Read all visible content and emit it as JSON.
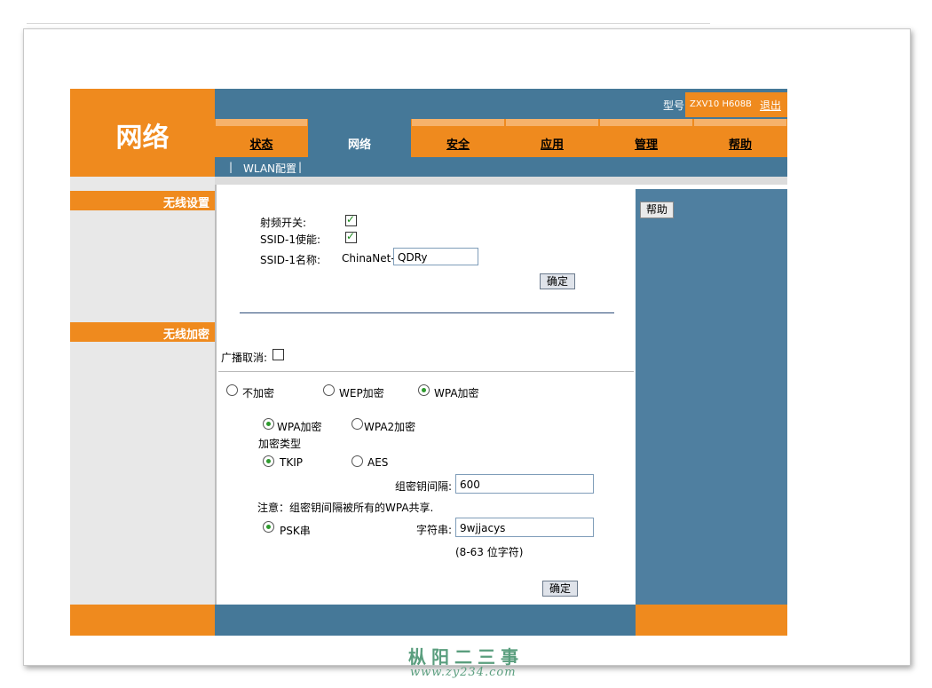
{
  "header": {
    "brand_title": "网络",
    "model_label": "型号",
    "model_value": "ZXV10 H608B",
    "logout_label": "退出"
  },
  "tabs": [
    {
      "label": "状态",
      "active": false
    },
    {
      "label": "网络",
      "active": true
    },
    {
      "label": "安全",
      "active": false
    },
    {
      "label": "应用",
      "active": false
    },
    {
      "label": "管理",
      "active": false
    },
    {
      "label": "帮助",
      "active": false
    }
  ],
  "subnav": {
    "sep_left": "|",
    "item": "WLAN配置",
    "sep_right": "|"
  },
  "sidebar": {
    "wireless_settings": "无线设置",
    "wireless_encryption": "无线加密"
  },
  "help": {
    "button_label": "帮助"
  },
  "wireless_settings": {
    "rf_switch_label": "射频开关:",
    "rf_switch_checked": true,
    "ssid1_enable_label": "SSID-1使能:",
    "ssid1_enable_checked": true,
    "ssid1_name_label": "SSID-1名称:",
    "ssid1_prefix": "ChinaNet-",
    "ssid1_name_value": "QDRy",
    "confirm_label": "确定"
  },
  "wireless_encryption": {
    "broadcast_cancel_label": "广播取消:",
    "broadcast_cancel_checked": false,
    "mode_options": [
      {
        "label": "不加密",
        "selected": false
      },
      {
        "label": "WEP加密",
        "selected": false
      },
      {
        "label": "WPA加密",
        "selected": true
      }
    ],
    "wpa_version_options": [
      {
        "label": "WPA加密",
        "selected": true
      },
      {
        "label": "WPA2加密",
        "selected": false
      }
    ],
    "encryption_type_label": "加密类型",
    "cipher_options": [
      {
        "label": "TKIP",
        "selected": true
      },
      {
        "label": "AES",
        "selected": false
      }
    ],
    "group_key_interval_label": "组密钥间隔:",
    "group_key_interval_value": "600",
    "note": "注意：组密钥间隔被所有的WPA共享.",
    "psk_option_label": "PSK串",
    "psk_selected": true,
    "psk_string_label": "字符串:",
    "psk_string_value": "9wjjacys",
    "psk_hint": "(8-63 位字符)",
    "confirm_label": "确定"
  },
  "watermark": {
    "title": "枞阳二三事",
    "url": "www.zy234.com"
  }
}
